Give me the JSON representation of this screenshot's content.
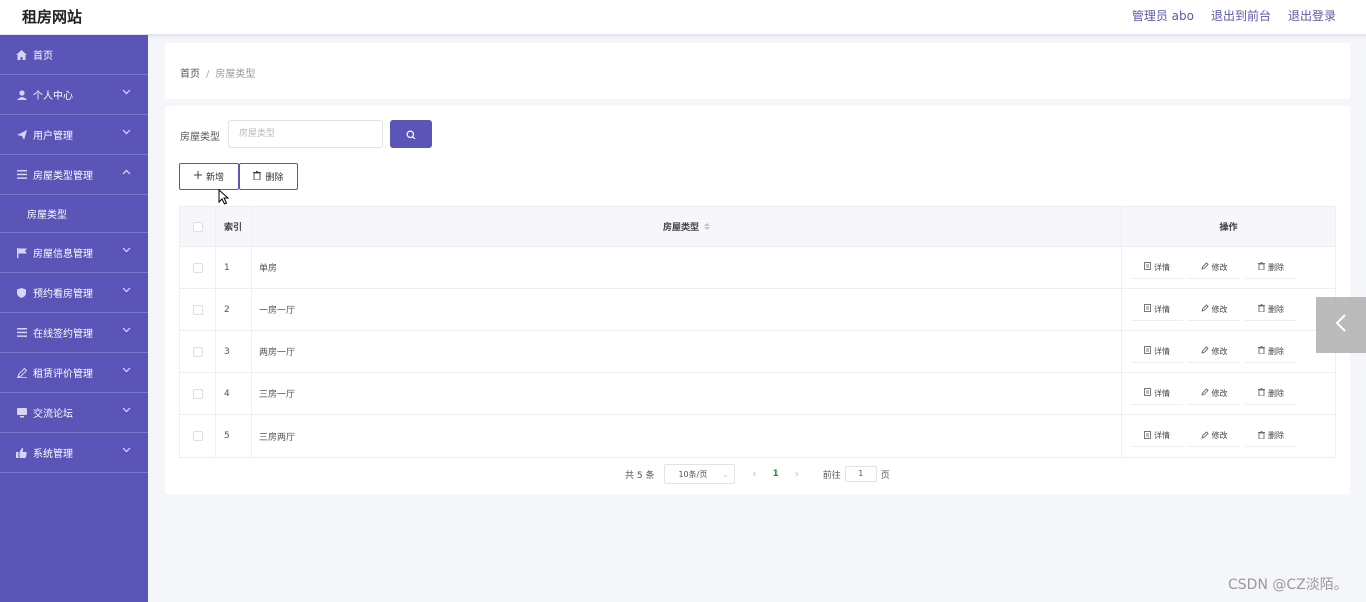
{
  "header": {
    "brand": "租房网站",
    "links": [
      "管理员 abo",
      "退出到前台",
      "退出登录"
    ]
  },
  "sidebar": {
    "items": [
      {
        "label": "首页",
        "icon": "home-icon"
      },
      {
        "label": "个人中心",
        "icon": "user-icon"
      },
      {
        "label": "用户管理",
        "icon": "send-icon"
      },
      {
        "label": "房屋类型管理",
        "icon": "list-icon"
      },
      {
        "label": "房屋类型",
        "icon": ""
      },
      {
        "label": "房屋信息管理",
        "icon": "flag-icon"
      },
      {
        "label": "预约看房管理",
        "icon": "shield-icon"
      },
      {
        "label": "在线签约管理",
        "icon": "list-icon"
      },
      {
        "label": "租赁评价管理",
        "icon": "edit-icon"
      },
      {
        "label": "交流论坛",
        "icon": "monitor-icon"
      },
      {
        "label": "系统管理",
        "icon": "thumb-icon"
      }
    ]
  },
  "breadcrumb": {
    "home": "首页",
    "sep": "/",
    "current": "房屋类型"
  },
  "search": {
    "label": "房屋类型",
    "placeholder": "房屋类型"
  },
  "toolbar": {
    "add": "新增",
    "delete": "删除"
  },
  "table": {
    "headers": {
      "index": "索引",
      "type": "房屋类型",
      "ops": "操作"
    },
    "rows": [
      {
        "index": "1",
        "type": "单房"
      },
      {
        "index": "2",
        "type": "一房一厅"
      },
      {
        "index": "3",
        "type": "两房一厅"
      },
      {
        "index": "4",
        "type": "三房一厅"
      },
      {
        "index": "5",
        "type": "三房两厅"
      }
    ],
    "actions": {
      "detail": "详情",
      "edit": "修改",
      "delete": "删除"
    }
  },
  "pager": {
    "total": "共 5 条",
    "size": "10条/页",
    "page": "1",
    "goto_prefix": "前往",
    "goto_value": "1",
    "goto_suffix": "页"
  },
  "watermark": "CSDN @CZ淡陌。",
  "colors": {
    "primary": "#5a55b6",
    "pageBg": "#f5f6fa"
  }
}
